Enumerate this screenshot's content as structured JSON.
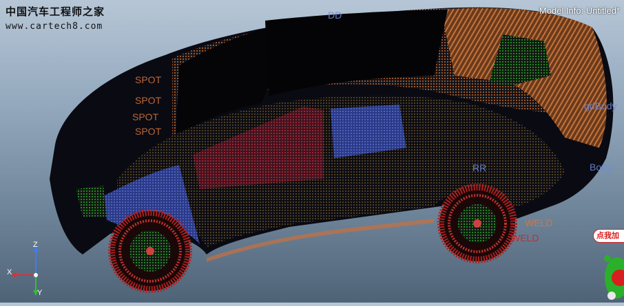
{
  "watermark": {
    "title_cn": "中国汽车工程师之家",
    "url": "www.cartech8.com"
  },
  "header": {
    "model_info": "Model Info: Untitled*"
  },
  "mesh_labels": {
    "spot_1": "SPOT",
    "spot_2": "SPOT",
    "spot_3": "SPOT",
    "spot_4": "SPOT",
    "gd_body": "gdBody",
    "weld_1": "WELD",
    "weld_2": "WELD",
    "body": "Body",
    "rr": "RR",
    "dd": "DD"
  },
  "triad": {
    "z": "Z",
    "x": "X",
    "y": "Y"
  },
  "ad": {
    "text": "点我加"
  },
  "colors": {
    "mesh_orange": "#b2622c",
    "panel_blue": "#3c4ea0",
    "panel_red": "#a01830",
    "tire_red": "#b02020",
    "rim_green": "#2a8a2a",
    "body_dark": "#0a0a12"
  }
}
